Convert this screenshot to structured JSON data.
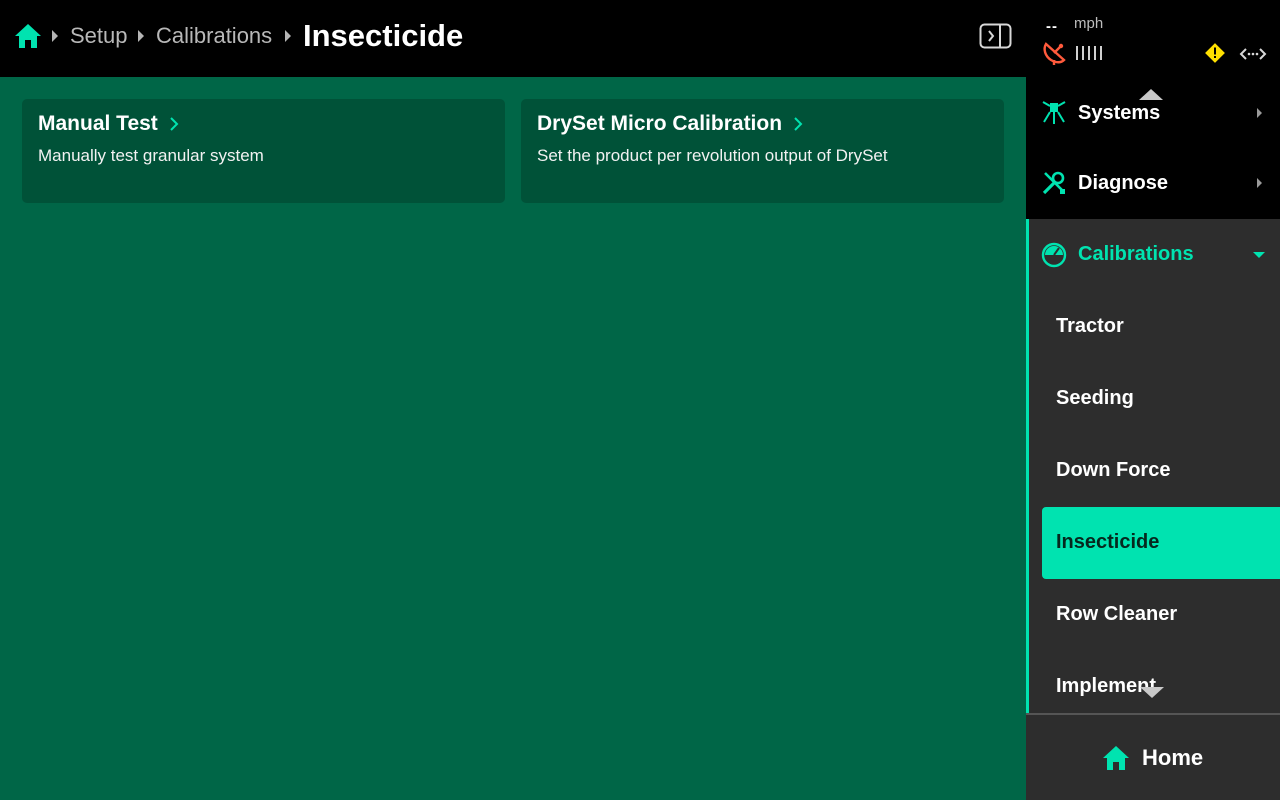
{
  "header": {
    "breadcrumbs": [
      "Setup",
      "Calibrations"
    ],
    "current": "Insecticide"
  },
  "cards": [
    {
      "title": "Manual Test",
      "description": "Manually test granular system"
    },
    {
      "title": "DrySet Micro Calibration",
      "description": "Set the product per revolution output of DrySet"
    }
  ],
  "status": {
    "speed_value": "--",
    "speed_unit": "mph"
  },
  "nav": {
    "items": [
      "Systems",
      "Diagnose"
    ],
    "expanded": {
      "label": "Calibrations",
      "children": [
        "Tractor",
        "Seeding",
        "Down Force",
        "Insecticide",
        "Row Cleaner",
        "Implement"
      ],
      "active": "Insecticide"
    }
  },
  "home_button": {
    "label": "Home"
  },
  "colors": {
    "accent": "#00e3b0",
    "content_bg": "#006647",
    "card_bg": "#005238",
    "panel_bg": "#2d2d2d",
    "warning": "#ffe000",
    "gps_error": "#ff5a3c"
  }
}
